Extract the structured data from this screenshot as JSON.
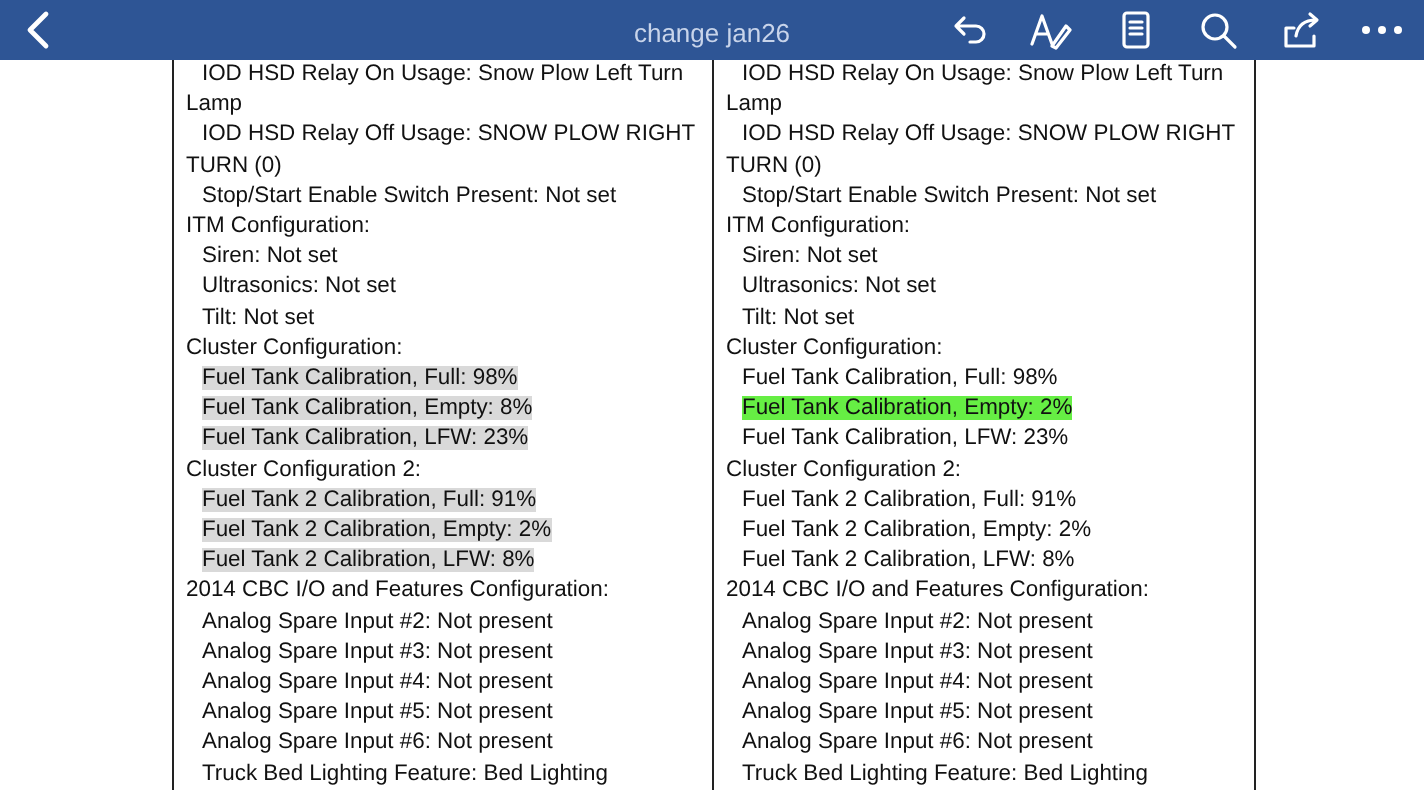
{
  "toolbar": {
    "title": "change jan26"
  },
  "documents": [
    {
      "sections": [
        {
          "children": [
            {
              "text": "IOD HSD Relay On Usage: Snow Plow Left Turn Lamp"
            },
            {
              "text": "IOD HSD Relay Off Usage: SNOW PLOW RIGHT TURN (0)"
            },
            {
              "text": "Stop/Start Enable Switch Present: Not set"
            }
          ]
        },
        {
          "text": "ITM Configuration:",
          "children": [
            {
              "text": "Siren: Not set"
            },
            {
              "text": "Ultrasonics: Not set"
            },
            {
              "text": "Tilt: Not set"
            }
          ]
        },
        {
          "text": "Cluster Configuration:",
          "children": [
            {
              "text": "Fuel Tank Calibration, Full: 98%",
              "color": "#d9d9d9"
            },
            {
              "text": "Fuel Tank Calibration, Empty: 8%",
              "color": "#d9d9d9"
            },
            {
              "text": "Fuel Tank Calibration, LFW: 23%",
              "color": "#d9d9d9"
            }
          ]
        },
        {
          "text": "Cluster Configuration 2:",
          "children": [
            {
              "text": "Fuel Tank 2 Calibration, Full: 91%",
              "color": "#d9d9d9"
            },
            {
              "text": "Fuel Tank 2 Calibration, Empty: 2%",
              "color": "#d9d9d9"
            },
            {
              "text": "Fuel Tank 2 Calibration, LFW: 8%",
              "color": "#d9d9d9"
            }
          ]
        },
        {
          "text": "2014 CBC I/O and Features Configuration:",
          "children": [
            {
              "text": "Analog Spare Input #2: Not present"
            },
            {
              "text": "Analog Spare Input #3: Not present"
            },
            {
              "text": "Analog Spare Input #4: Not present"
            },
            {
              "text": "Analog Spare Input #5: Not present"
            },
            {
              "text": "Analog Spare Input #6: Not present"
            },
            {
              "text": "Truck Bed Lighting Feature: Bed Lighting"
            }
          ]
        }
      ]
    },
    {
      "sections": [
        {
          "children": [
            {
              "text": "IOD HSD Relay On Usage: Snow Plow Left Turn Lamp"
            },
            {
              "text": "IOD HSD Relay Off Usage: SNOW PLOW RIGHT TURN (0)"
            },
            {
              "text": "Stop/Start Enable Switch Present: Not set"
            }
          ]
        },
        {
          "text": "ITM Configuration:",
          "children": [
            {
              "text": "Siren: Not set"
            },
            {
              "text": "Ultrasonics: Not set"
            },
            {
              "text": "Tilt: Not set"
            }
          ]
        },
        {
          "text": "Cluster Configuration:",
          "children": [
            {
              "text": "Fuel Tank Calibration, Full: 98%"
            },
            {
              "text": "Fuel Tank Calibration, Empty: 2%",
              "color": "#66ee44"
            },
            {
              "text": "Fuel Tank Calibration, LFW: 23%"
            }
          ]
        },
        {
          "text": "Cluster Configuration 2:",
          "children": [
            {
              "text": "Fuel Tank 2 Calibration, Full: 91%"
            },
            {
              "text": "Fuel Tank 2 Calibration, Empty: 2%"
            },
            {
              "text": "Fuel Tank 2 Calibration, LFW: 8%"
            }
          ]
        },
        {
          "text": "2014 CBC I/O and Features Configuration:",
          "children": [
            {
              "text": "Analog Spare Input #2: Not present"
            },
            {
              "text": "Analog Spare Input #3: Not present"
            },
            {
              "text": "Analog Spare Input #4: Not present"
            },
            {
              "text": "Analog Spare Input #5: Not present"
            },
            {
              "text": "Analog Spare Input #6: Not present"
            },
            {
              "text": "Truck Bed Lighting Feature: Bed Lighting"
            }
          ]
        }
      ]
    }
  ]
}
